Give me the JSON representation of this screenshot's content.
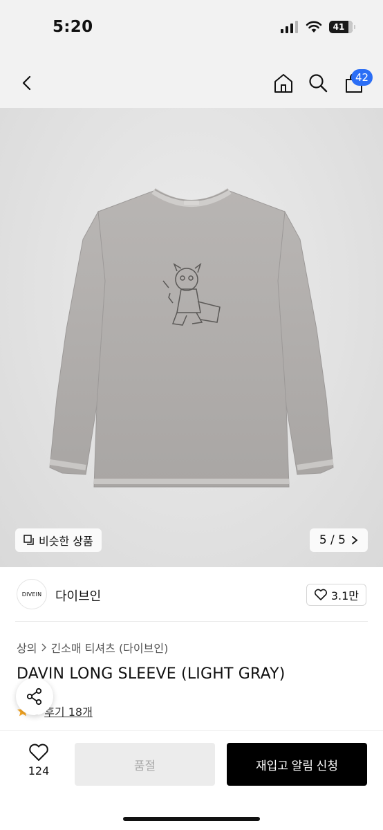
{
  "status_bar": {
    "time": "5:20",
    "battery_level": "41"
  },
  "nav": {
    "back_icon": "chevron-left-icon",
    "home_icon": "home-icon",
    "search_icon": "search-icon",
    "cart_icon": "shopping-bag-icon",
    "cart_badge": "42",
    "badge_color": "#2b6ef5"
  },
  "gallery": {
    "similar_products_label": "비슷한 상품",
    "page_indicator": "5 / 5"
  },
  "brand": {
    "logo_text": "DIVEIN",
    "name": "다이브인",
    "likes": "3.1만"
  },
  "breadcrumb": {
    "category": "상의",
    "subcategory": "긴소매 티셔츠 (다이브인)"
  },
  "product": {
    "title": "DAVIN LONG SLEEVE (LIGHT GRAY)",
    "rating": "5",
    "review_link": "후기 18개"
  },
  "bottom_bar": {
    "wish_count": "124",
    "soldout_label": "품절",
    "restock_label": "재입고 알림 신청"
  }
}
